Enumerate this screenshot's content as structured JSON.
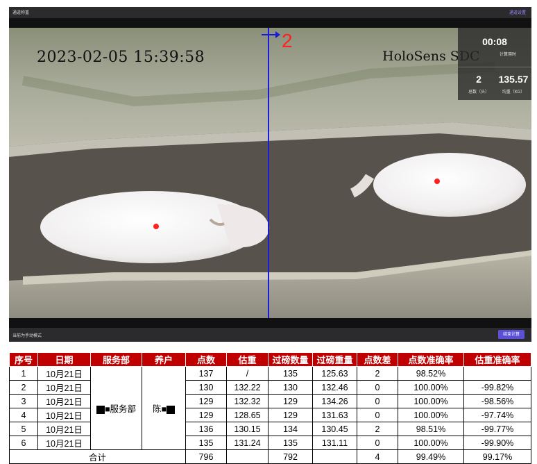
{
  "header": {
    "title": "通道称重",
    "right_action": "通道设置"
  },
  "video": {
    "osd_datetime": "2023-02-05 15:39:58",
    "osd_brand": "HoloSens SDC",
    "line_marker": "2",
    "stats": {
      "elapsed_time": "00:08",
      "elapsed_time_label": "计算用时",
      "count": "2",
      "count_label": "总数（头）",
      "avg_weight": "135.57",
      "avg_weight_label": "均重（KG）"
    }
  },
  "controls": {
    "mode_text": "当前为手动模式",
    "button_label": "结束计算"
  },
  "table": {
    "headers": [
      "序号",
      "日期",
      "服务部",
      "养户",
      "点数",
      "估重",
      "过磅数量",
      "过磅重量",
      "点数差",
      "点数准确率",
      "估重准确率"
    ],
    "merged": {
      "department": "■服务部",
      "farmer": "陈■"
    },
    "rows": [
      {
        "no": "1",
        "date": "10月21日",
        "count": "137",
        "est_weight": "/",
        "scale_qty": "135",
        "scale_weight": "125.63",
        "diff": "2",
        "count_acc": "98.52%",
        "weight_acc": ""
      },
      {
        "no": "2",
        "date": "10月21日",
        "count": "130",
        "est_weight": "132.22",
        "scale_qty": "130",
        "scale_weight": "132.46",
        "diff": "0",
        "count_acc": "100.00%",
        "weight_acc": "-99.82%"
      },
      {
        "no": "3",
        "date": "10月21日",
        "count": "129",
        "est_weight": "132.32",
        "scale_qty": "129",
        "scale_weight": "134.26",
        "diff": "0",
        "count_acc": "100.00%",
        "weight_acc": "-98.56%"
      },
      {
        "no": "4",
        "date": "10月21日",
        "count": "129",
        "est_weight": "128.65",
        "scale_qty": "129",
        "scale_weight": "131.63",
        "diff": "0",
        "count_acc": "100.00%",
        "weight_acc": "-97.74%"
      },
      {
        "no": "5",
        "date": "10月21日",
        "count": "136",
        "est_weight": "130.15",
        "scale_qty": "134",
        "scale_weight": "130.45",
        "diff": "2",
        "count_acc": "98.51%",
        "weight_acc": "-99.77%"
      },
      {
        "no": "6",
        "date": "10月21日",
        "count": "135",
        "est_weight": "131.24",
        "scale_qty": "135",
        "scale_weight": "131.11",
        "diff": "0",
        "count_acc": "100.00%",
        "weight_acc": "-99.90%"
      }
    ],
    "total": {
      "label": "合计",
      "count": "796",
      "scale_qty": "792",
      "diff": "4",
      "count_acc": "99.49%",
      "weight_acc": "99.17%"
    }
  },
  "colors": {
    "header_red": "#c00000",
    "line_blue": "#1a1adc",
    "marker_red": "#ff2020",
    "button_purple": "#5a4fd6"
  },
  "icons": [
    "arrow-right-icon"
  ]
}
